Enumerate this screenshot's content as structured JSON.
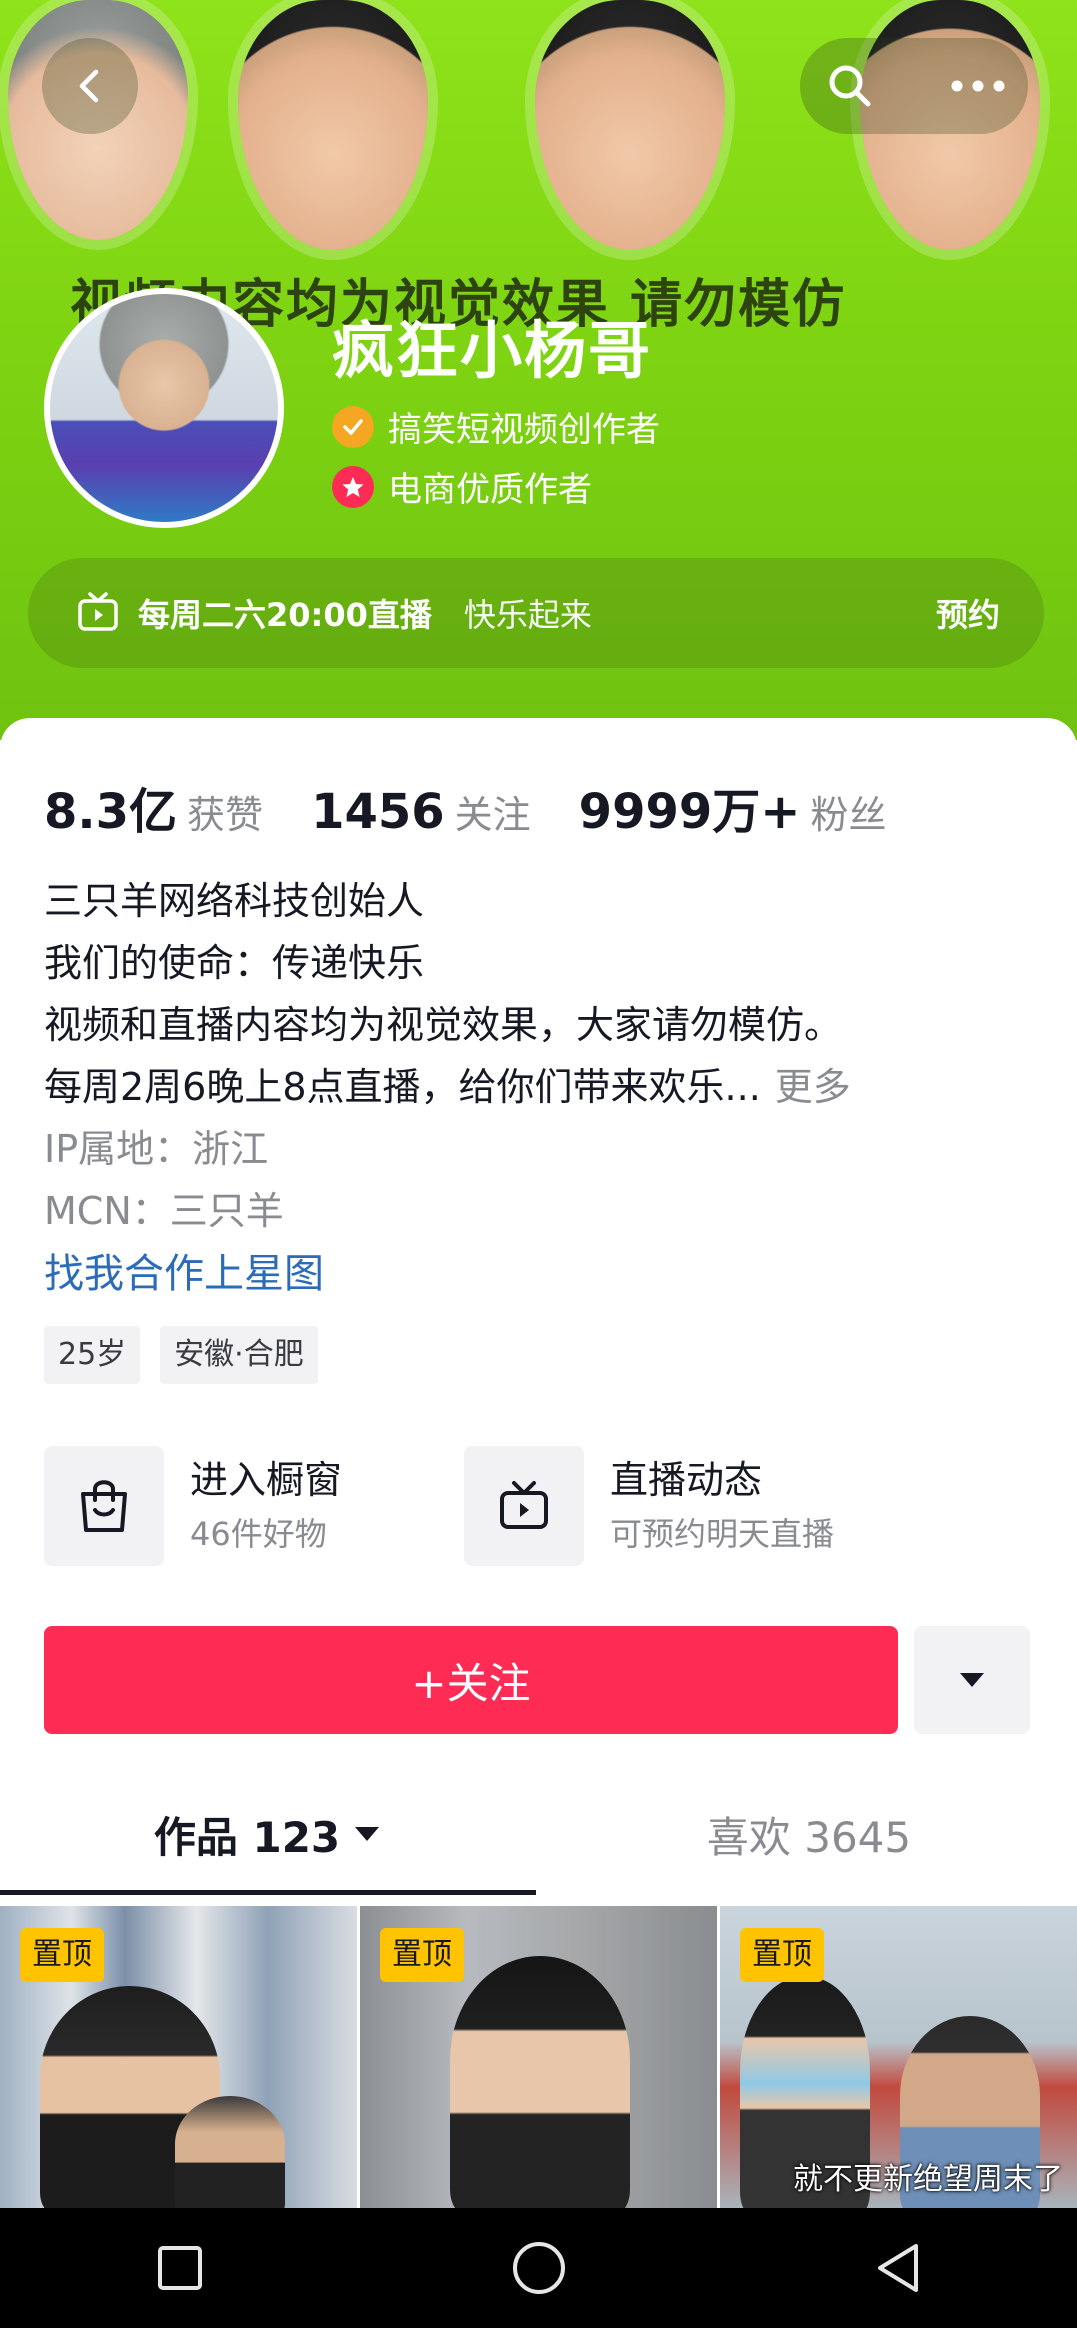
{
  "header": {
    "banner_slogan": "视频内容均为视觉效果 请勿模仿",
    "nickname": "疯狂小杨哥",
    "certifications": [
      {
        "label": "搞笑短视频创作者",
        "icon": "check-badge-icon",
        "color": "#f5a623"
      },
      {
        "label": "电商优质作者",
        "icon": "star-badge-icon",
        "color": "#fe2c55"
      }
    ],
    "live_schedule": {
      "time": "每周二六20:00直播",
      "slogan": "快乐起来",
      "reserve_label": "预约"
    }
  },
  "stats": [
    {
      "value": "8.3亿",
      "label": "获赞"
    },
    {
      "value": "1456",
      "label": "关注"
    },
    {
      "value": "9999万+",
      "label": "粉丝"
    }
  ],
  "bio": {
    "lines": [
      "三只羊网络科技创始人",
      "我们的使命：传递快乐",
      "视频和直播内容均为视觉效果，大家请勿模仿。",
      "每周2周6晚上8点直播，给你们带来欢乐..."
    ],
    "more_label": "更多",
    "ip_location": "IP属地：浙江",
    "mcn": "MCN：三只羊",
    "xingtu_link": "找我合作上星图"
  },
  "tags": [
    "25岁",
    "安徽·合肥"
  ],
  "entries": [
    {
      "title": "进入橱窗",
      "subtitle": "46件好物",
      "icon": "shopping-bag-icon"
    },
    {
      "title": "直播动态",
      "subtitle": "可预约明天直播",
      "icon": "tv-icon"
    }
  ],
  "follow_label": "+关注",
  "tabs": {
    "works": "作品 123",
    "likes": "喜欢 3645"
  },
  "videos": [
    {
      "pinned_label": "置顶",
      "caption": ""
    },
    {
      "pinned_label": "置顶",
      "caption": ""
    },
    {
      "pinned_label": "置顶",
      "caption": "就不更新绝望周末了"
    }
  ],
  "colors": {
    "banner_green": "#8fe31a",
    "follow_red": "#fe2c55",
    "link_blue": "#2b6bb7",
    "pin_yellow": "#ffc300"
  }
}
